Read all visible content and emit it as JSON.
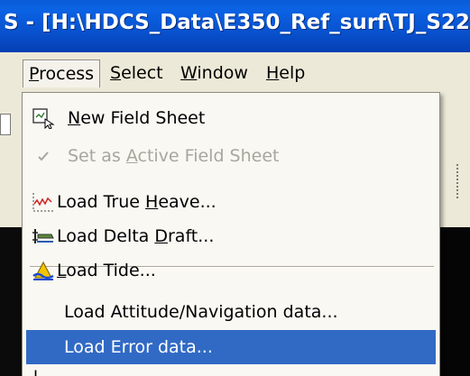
{
  "window": {
    "title": "S - [H:\\HDCS_Data\\E350_Ref_surf\\TJ_S22"
  },
  "menubar": {
    "items": [
      {
        "label": "Process",
        "mnemonic": "P",
        "rest": "rocess",
        "active": true
      },
      {
        "label": "Select",
        "mnemonic": "S",
        "rest": "elect"
      },
      {
        "label": "Window",
        "mnemonic": "W",
        "rest": "indow"
      },
      {
        "label": "Help",
        "mnemonic": "H",
        "rest": "elp"
      }
    ]
  },
  "dropdown": {
    "items": [
      {
        "pre": "",
        "mn": "N",
        "post": "ew Field Sheet",
        "icon": "new-field-sheet-icon",
        "enabled": true
      },
      {
        "pre": "Set as ",
        "mn": "A",
        "post": "ctive Field Sheet",
        "icon": "checkmark-icon",
        "enabled": false
      },
      {
        "pre": "Load True ",
        "mn": "H",
        "post": "eave...",
        "icon": "true-heave-icon",
        "enabled": true
      },
      {
        "pre": "Load Delta ",
        "mn": "D",
        "post": "raft...",
        "icon": "delta-draft-icon",
        "enabled": true
      },
      {
        "pre": "",
        "mn": "L",
        "post": "oad Tide...",
        "icon": "tide-icon",
        "enabled": true
      },
      {
        "pre": "Load Attitude/Navigation data...",
        "mn": "",
        "post": "",
        "icon": "",
        "enabled": true
      },
      {
        "pre": "Load Error data...",
        "mn": "",
        "post": "",
        "icon": "",
        "enabled": true,
        "highlighted": true
      }
    ],
    "cut_item_fragment": "I"
  },
  "colors": {
    "titlebar": "#0852cf",
    "highlight": "#316ac5",
    "menu_bg": "#ece9d8"
  }
}
